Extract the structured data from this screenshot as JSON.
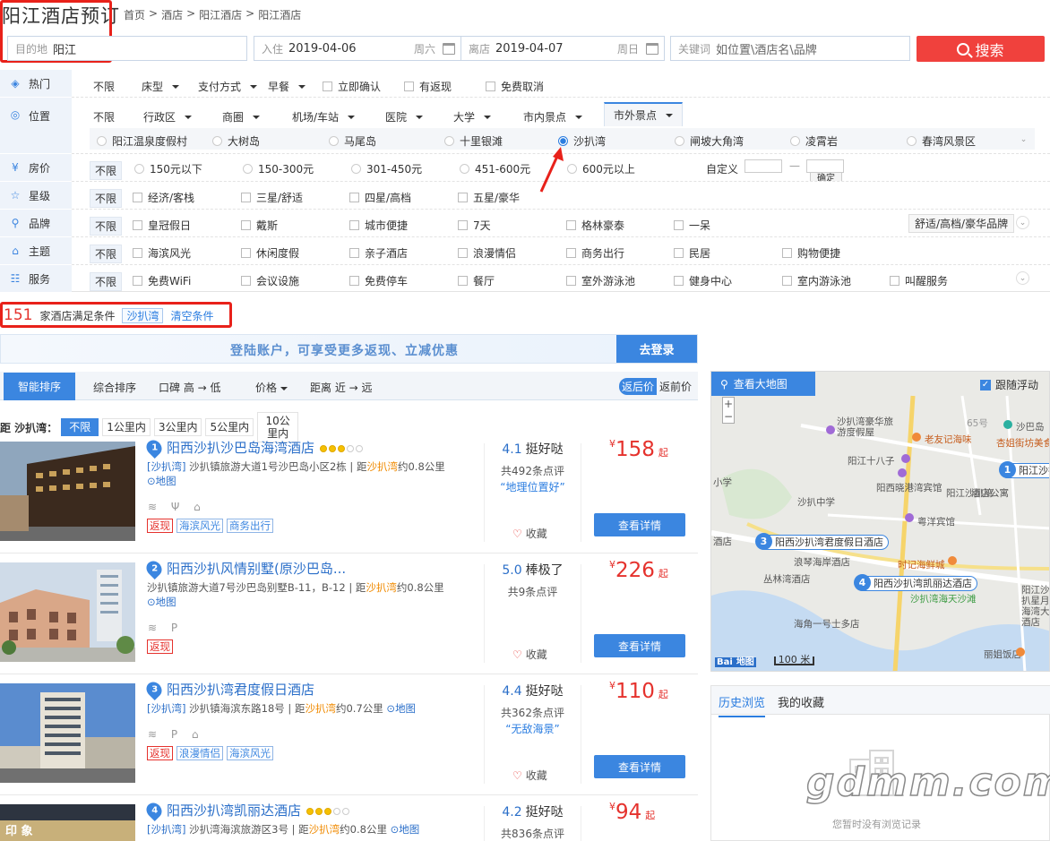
{
  "header": {
    "title": "阳江酒店预订",
    "breadcrumb": [
      "首页",
      ">",
      "酒店",
      ">",
      "阳江酒店",
      ">",
      "阳江酒店"
    ]
  },
  "search": {
    "dest_label": "目的地",
    "dest_value": "阳江",
    "checkin_label": "入住",
    "checkin_value": "2019-04-06",
    "checkin_weekday": "周六",
    "checkout_label": "离店",
    "checkout_value": "2019-04-07",
    "checkout_weekday": "周日",
    "keyword_label": "关键词",
    "keyword_placeholder": "如位置\\酒店名\\品牌",
    "search_button": "搜索"
  },
  "filters": {
    "hot": {
      "label": "热门",
      "items": [
        "不限",
        "床型",
        "支付方式",
        "早餐",
        "立即确认",
        "有返现",
        "免费取消"
      ]
    },
    "location": {
      "label": "位置",
      "tabs": [
        "不限",
        "行政区",
        "商圈",
        "机场/车站",
        "医院",
        "大学",
        "市内景点",
        "市外景点"
      ],
      "sub": [
        "阳江温泉度假村",
        "大树岛",
        "马尾岛",
        "十里银滩",
        "沙扒湾",
        "闸坡大角湾",
        "凌霄岩",
        "春湾风景区"
      ],
      "selected": "沙扒湾"
    },
    "price": {
      "label": "房价",
      "items": [
        "不限",
        "150元以下",
        "150-300元",
        "301-450元",
        "451-600元",
        "600元以上"
      ],
      "custom": "自定义",
      "dash": "—",
      "confirm": "确定"
    },
    "star": {
      "label": "星级",
      "items": [
        "不限",
        "经济/客栈",
        "三星/舒适",
        "四星/高档",
        "五星/豪华"
      ]
    },
    "brand": {
      "label": "品牌",
      "items": [
        "不限",
        "皇冠假日",
        "戴斯",
        "城市便捷",
        "7天",
        "格林豪泰",
        "一呆"
      ],
      "dropdown": "舒适/高档/豪华品牌"
    },
    "theme": {
      "label": "主题",
      "items": [
        "不限",
        "海滨风光",
        "休闲度假",
        "亲子酒店",
        "浪漫情侣",
        "商务出行",
        "民居",
        "购物便捷"
      ]
    },
    "service": {
      "label": "服务",
      "items": [
        "不限",
        "免费WiFi",
        "会议设施",
        "免费停车",
        "餐厅",
        "室外游泳池",
        "健身中心",
        "室内游泳池",
        "叫醒服务"
      ]
    }
  },
  "results": {
    "count": "151",
    "count_text": "家酒店满足条件",
    "active_tag": "沙扒湾",
    "clear": "清空条件"
  },
  "banner": {
    "message": "登陆账户，可享受更多返现、立减优惠",
    "login": "去登录"
  },
  "sort": {
    "items": [
      "智能排序",
      "综合排序",
      "口碑 高 → 低",
      "价格",
      "距离 近 → 远"
    ],
    "price_after": "返后价",
    "price_before": "返前价"
  },
  "distance": {
    "label": "距 沙扒湾：",
    "items": [
      "不限",
      "1公里内",
      "3公里内",
      "5公里内",
      "10公里内"
    ]
  },
  "hotels": [
    {
      "no": "1",
      "name": "阳西沙扒沙巴岛海湾酒店",
      "area": "[沙扒湾]",
      "addr": "沙扒镇旅游大道1号沙巴岛小区2栋",
      "dist_pre": "距",
      "dist_place": "沙扒湾",
      "dist_val": "约0.8公里",
      "map": "地图",
      "amen": "≋ Ψ ⌂",
      "badges": [
        "返现",
        "海滨风光",
        "商务出行"
      ],
      "score": "4.1",
      "score_word": "挺好哒",
      "reviews": "共492条点评",
      "quote": "“地理位置好”",
      "fav": "收藏",
      "price": "158",
      "cur": "¥",
      "qi": "起",
      "detail": "查看详情",
      "stars": 2
    },
    {
      "no": "2",
      "name": "阳西沙扒风情别墅(原沙巴岛...",
      "area": "",
      "addr": "沙扒镇旅游大道7号沙巴岛别墅B-11，B-12",
      "dist_pre": "距",
      "dist_place": "沙扒湾",
      "dist_val": "约0.8公里",
      "map": "地图",
      "amen": "≋ P",
      "badges": [
        "返现"
      ],
      "score": "5.0",
      "score_word": "棒极了",
      "reviews": "共9条点评",
      "quote": "",
      "fav": "收藏",
      "price": "226",
      "cur": "¥",
      "qi": "起",
      "detail": "查看详情",
      "stars": 0
    },
    {
      "no": "3",
      "name": "阳西沙扒湾君度假日酒店",
      "area": "[沙扒湾]",
      "addr": "沙扒镇海滨东路18号",
      "dist_pre": "距",
      "dist_place": "沙扒湾",
      "dist_val": "约0.7公里",
      "map": "地图",
      "amen": "≋ P ⌂",
      "badges": [
        "返现",
        "浪漫情侣",
        "海滨风光"
      ],
      "score": "4.4",
      "score_word": "挺好哒",
      "reviews": "共362条点评",
      "quote": "“无敌海景”",
      "fav": "收藏",
      "price": "110",
      "cur": "¥",
      "qi": "起",
      "detail": "查看详情",
      "stars": 0
    },
    {
      "no": "4",
      "name": "阳西沙扒湾凯丽达酒店",
      "area": "[沙扒湾]",
      "addr": "沙扒湾海滨旅游区3号",
      "dist_pre": "距",
      "dist_place": "沙扒湾",
      "dist_val": "约0.8公里",
      "map": "地图",
      "amen": "",
      "badges": [],
      "score": "4.2",
      "score_word": "挺好哒",
      "reviews": "共836条点评",
      "quote": "",
      "fav": "收藏",
      "price": "94",
      "cur": "¥",
      "qi": "起",
      "detail": "查看详情",
      "stars": 3
    }
  ],
  "map": {
    "title": "查看大地图",
    "follow": "跟随浮动",
    "labels": [
      "沙扒湾豪华旅游度假屋",
      "老友记海味",
      "沙巴岛",
      "杏姐街坊美食",
      "阳江十八子",
      "阳江沙扒湾",
      "沙扒中学",
      "阳西晓港湾宾馆",
      "粤洋宾馆",
      "浪琴海岸酒店",
      "丛林湾酒店",
      "时记海鲜城",
      "沙扒湾海天沙滩",
      "海角一号士多店",
      "丽姐饭店",
      "阳江沙扒星月海湾大酒店",
      "酒店公寓",
      "小学",
      "酒店",
      "65号"
    ],
    "pins": [
      {
        "no": "3",
        "name": "阳西沙扒湾君度假日酒店"
      },
      {
        "no": "4",
        "name": "阳西沙扒湾凯丽达酒店"
      },
      {
        "no": "1",
        "name": "阳江沙扒湾"
      }
    ],
    "scale": "100 米",
    "brand": "Bai",
    "brand_suffix": "地图"
  },
  "history": {
    "tabs": [
      "历史浏览",
      "我的收藏"
    ],
    "empty": "您暂时没有浏览记录"
  },
  "watermark": "gdmm.com",
  "colors": {
    "accent": "#3b86e0",
    "price": "#e5322d",
    "search": "#f0413d",
    "annotation": "#e8211a"
  }
}
